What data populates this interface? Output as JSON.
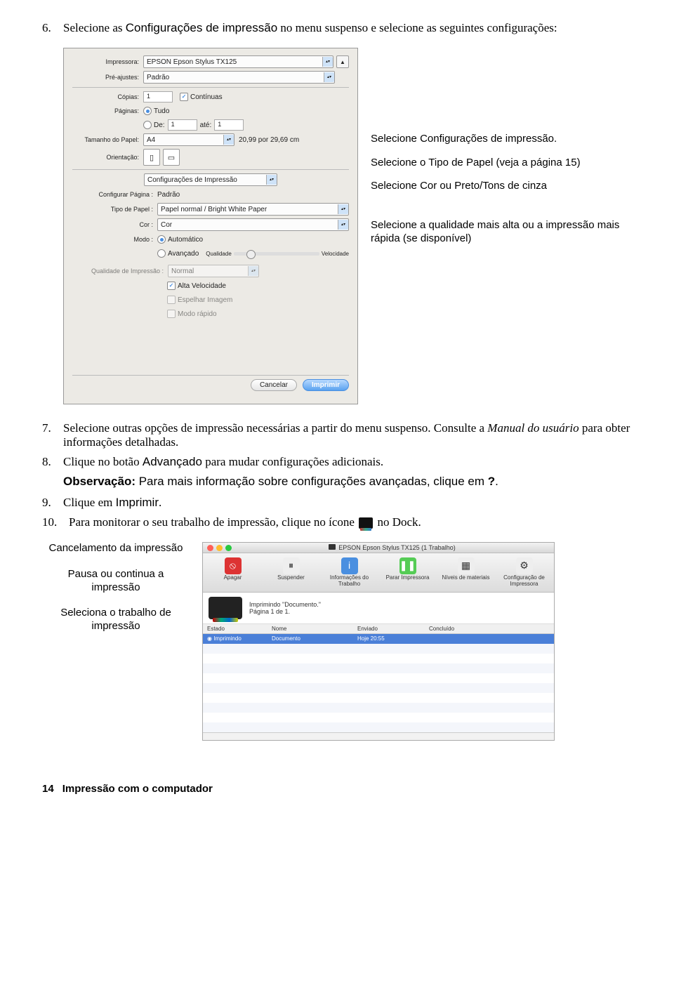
{
  "step6": {
    "num": "6.",
    "text_a": "Selecione as ",
    "text_b": "Configurações de impressão",
    "text_c": " no menu suspenso e selecione as seguintes configurações:"
  },
  "dialog": {
    "lbl_impressora": "Impressora:",
    "val_impressora": "EPSON Epson Stylus TX125",
    "lbl_preajustes": "Pré-ajustes:",
    "val_preajustes": "Padrão",
    "lbl_copias": "Cópias:",
    "val_copias": "1",
    "chk_continuas": "Contínuas",
    "lbl_paginas": "Páginas:",
    "rad_tudo": "Tudo",
    "rad_de": "De:",
    "val_de": "1",
    "lbl_ate": "até:",
    "val_ate": "1",
    "lbl_tamanho": "Tamanho do Papel:",
    "val_tamanho": "A4",
    "txt_dim": "20,99 por 29,69 cm",
    "lbl_orient": "Orientação:",
    "val_section": "Configurações de Impressão",
    "lbl_conf_pagina": "Configurar Página :",
    "val_conf_pagina": "Padrão",
    "lbl_tipo_papel": "Tipo de Papel :",
    "val_tipo_papel": "Papel normal / Bright White Paper",
    "lbl_cor": "Cor :",
    "val_cor": "Cor",
    "lbl_modo": "Modo :",
    "rad_auto": "Automático",
    "rad_avanc": "Avançado",
    "lbl_qual": "Qualidade",
    "lbl_vel": "Velocidade",
    "lbl_quali": "Qualidade de Impressão :",
    "val_quali": "Normal",
    "chk_alta": "Alta Velocidade",
    "chk_espelhar": "Espelhar Imagem",
    "chk_rapido": "Modo rápido",
    "btn_cancelar": "Cancelar",
    "btn_imprimir": "Imprimir"
  },
  "callouts": {
    "c1_a": "Selecione ",
    "c1_b": "Configurações de impressão",
    "c1_c": ".",
    "c2_a": "Selecione o ",
    "c2_b": "Tipo de Papel",
    "c2_c": " (veja a página 15)",
    "c3_a": "Selecione ",
    "c3_b": "Cor",
    "c3_c": " ou ",
    "c3_d": "Preto/Tons de cinza",
    "c4": "Selecione a qualidade mais alta ou a impressão mais rápida (se disponível)"
  },
  "step7": {
    "num": "7.",
    "text_a": "Selecione outras opções de impressão necessárias a partir do menu suspenso. Consulte a ",
    "text_b": "Manual do usuário",
    "text_c": " para obter informações detalhadas."
  },
  "step8": {
    "num": "8.",
    "text_a": "Clique no botão ",
    "text_b": "Advançado",
    "text_c": " para mudar configurações adicionais."
  },
  "note": {
    "label": "Observação:",
    "text_a": " Para mais informação sobre configurações avançadas, clique em ",
    "text_b": "?",
    "text_c": "."
  },
  "step9": {
    "num": "9.",
    "text_a": "Clique em ",
    "text_b": "Imprimir",
    "text_c": "."
  },
  "step10": {
    "num": "10.",
    "text_a": "Para monitorar o seu trabalho de impressão, clique no ícone ",
    "text_b": " no Dock."
  },
  "queue_callouts": {
    "c1": "Cancelamento da impressão",
    "c2": "Pausa ou continua a impressão",
    "c3": "Seleciona o trabalho de impressão"
  },
  "queue": {
    "title": "EPSON Epson Stylus TX125 (1 Trabalho)",
    "tb": {
      "apagar": "Apagar",
      "suspender": "Suspender",
      "info": "Informações do Trabalho",
      "parar": "Parar Impressora",
      "niveis": "Níveis de materiais",
      "conf": "Configuração de Impressora"
    },
    "status1": "Imprimindo \"Documento.\"",
    "status2": "Página 1 de 1.",
    "head": {
      "estado": "Estado",
      "nome": "Nome",
      "enviado": "Enviado",
      "conc": "Concluído"
    },
    "row": {
      "estado": "Imprimindo",
      "nome": "Documento",
      "enviado": "Hoje    20:55"
    }
  },
  "footer": {
    "page": "14",
    "title": "Impressão com o computador"
  }
}
